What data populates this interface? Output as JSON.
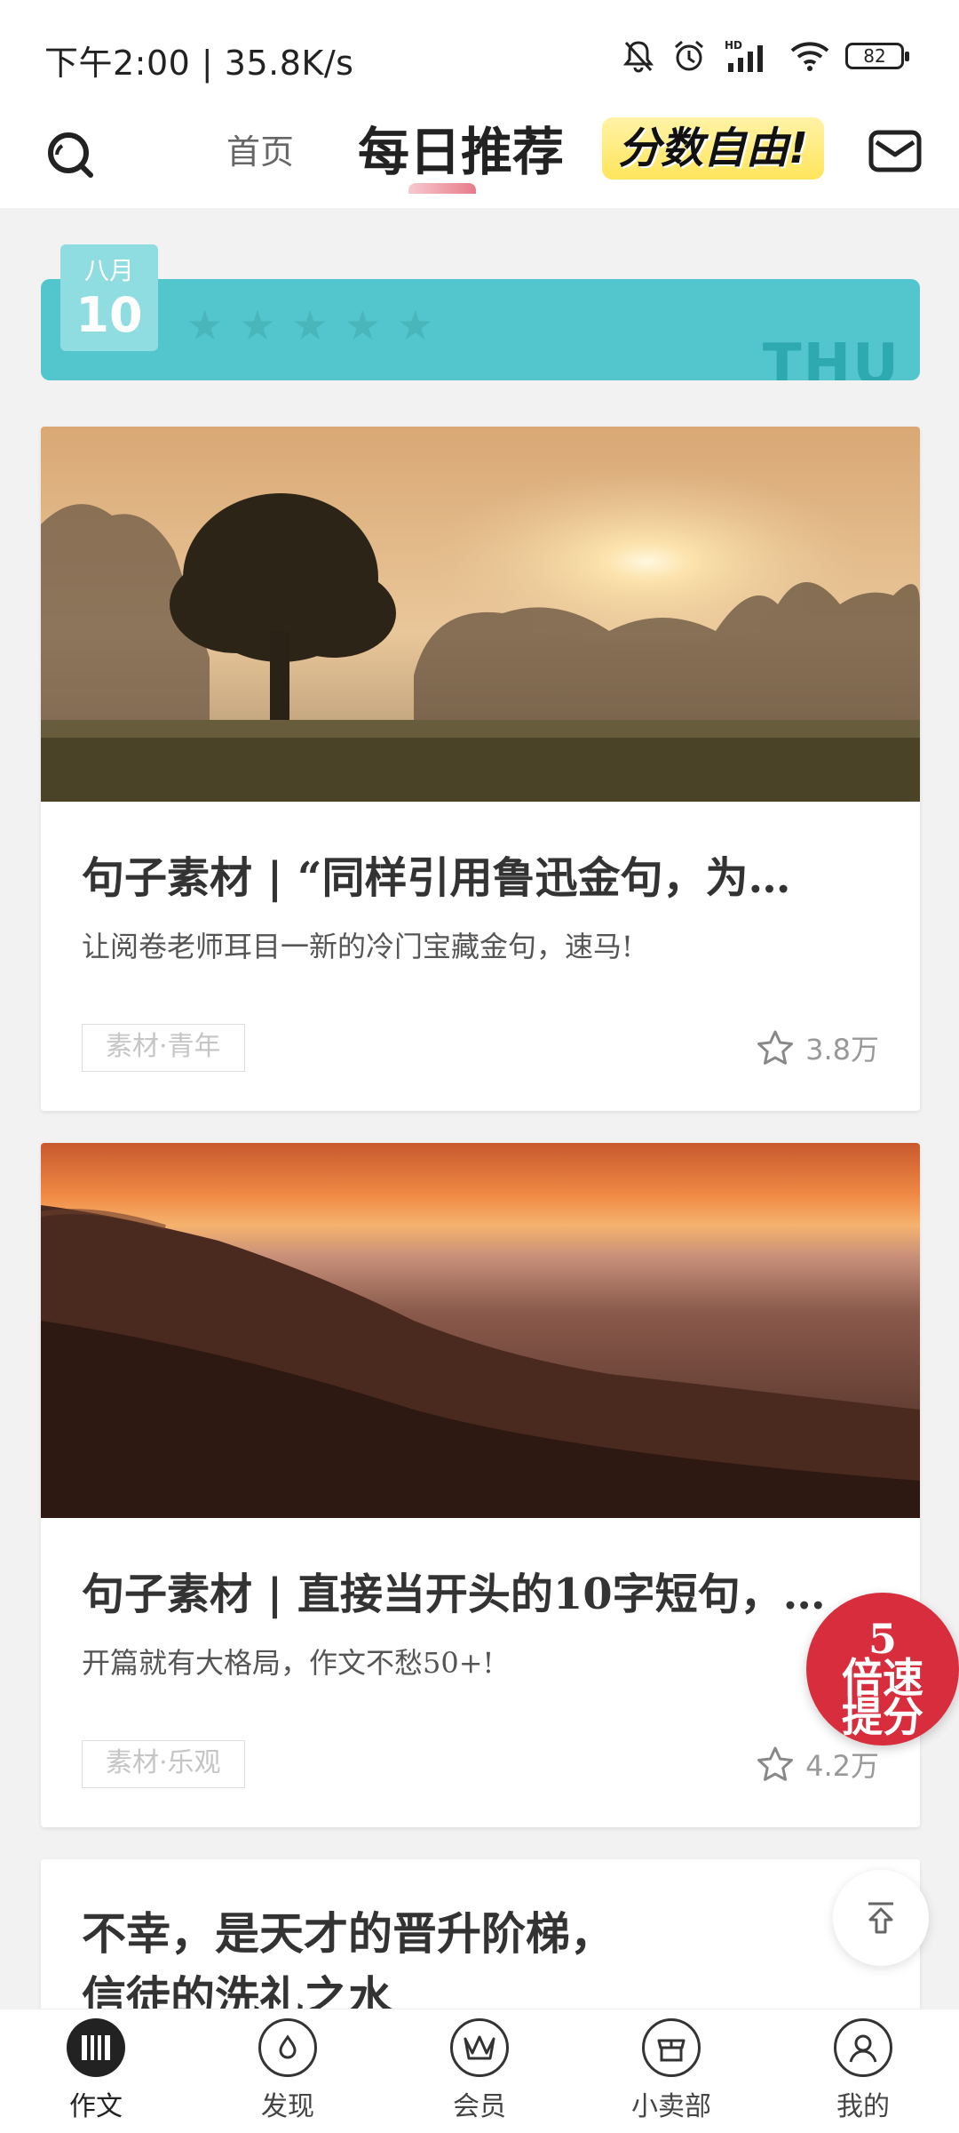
{
  "status_bar": {
    "time": "下午2:00 | 35.8K/s",
    "battery": "82",
    "icons": [
      "mute-bell-icon",
      "alarm-icon",
      "hd-signal-icon",
      "wifi-icon",
      "battery-icon"
    ]
  },
  "top_nav": {
    "home": "首页",
    "daily": "每日推荐",
    "promo": "分数自由!"
  },
  "date_banner": {
    "month": "八月",
    "day": "10",
    "weekday": "THU",
    "stars_count": 5,
    "colors": {
      "banner": "#52c6cc",
      "card": "#8fdce1"
    }
  },
  "articles": [
    {
      "title": "句子素材 | “同样引用鲁迅金句，为…",
      "subtitle": "让阅卷老师耳目一新的冷门宝藏金句，速马!",
      "tag": "素材·青年",
      "likes": "3.8万",
      "image": "misty-sunrise-tree"
    },
    {
      "title": "句子素材 | 直接当开头的10字短句，…",
      "subtitle": "开篇就有大格局，作文不愁50+!",
      "tag": "素材·乐观",
      "likes": "4.2万",
      "image": "sunset-coast-cliffs"
    }
  ],
  "article3": {
    "line1": "不幸，是天才的晋升阶梯，",
    "line2": "信徒的洗礼之水"
  },
  "promo_badge": {
    "line1": "5",
    "line2": "倍速",
    "line3": "提分"
  },
  "bottom_nav": {
    "tabs": [
      {
        "label": "作文",
        "icon": "essay-icon",
        "active": true
      },
      {
        "label": "发现",
        "icon": "discover-icon",
        "active": false
      },
      {
        "label": "会员",
        "icon": "member-crown-icon",
        "active": false
      },
      {
        "label": "小卖部",
        "icon": "shop-icon",
        "active": false
      },
      {
        "label": "我的",
        "icon": "profile-icon",
        "active": false
      }
    ]
  }
}
